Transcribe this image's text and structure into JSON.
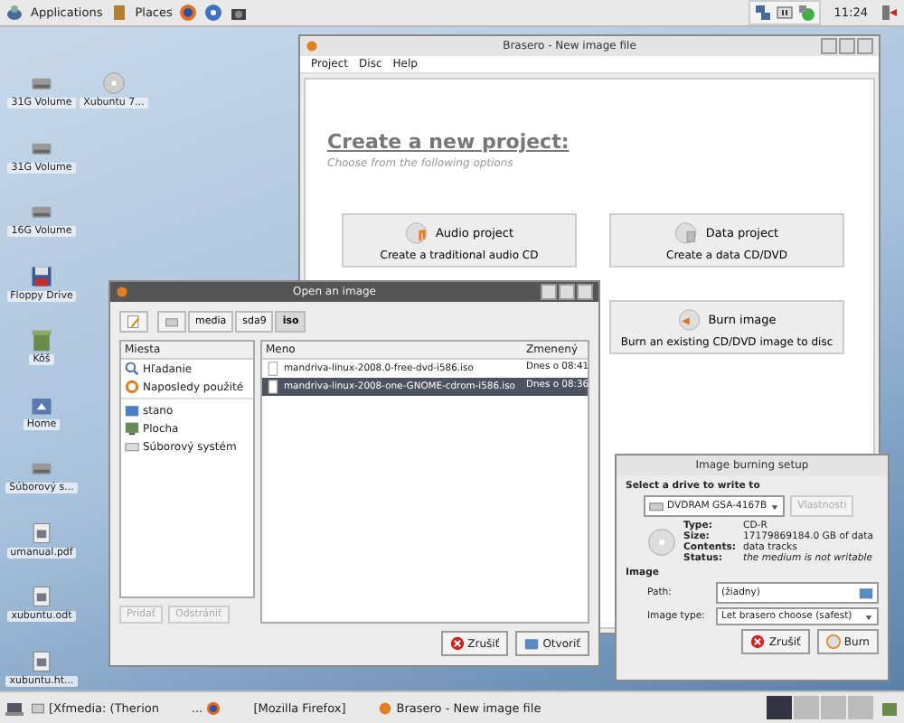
{
  "top_panel": {
    "menus": [
      {
        "label": "Applications",
        "kind": "apps"
      },
      {
        "label": "Places",
        "kind": "places"
      }
    ],
    "clock": "11:24"
  },
  "desktop_icons": [
    {
      "label": "31G Volume",
      "kind": "drive"
    },
    {
      "label": "Xubuntu 7...",
      "kind": "cdrom"
    },
    {
      "label": "31G Volume",
      "kind": "drive"
    },
    {
      "label": "16G Volume",
      "kind": "drive"
    },
    {
      "label": "Floppy Drive",
      "kind": "floppy"
    },
    {
      "label": "Kôš",
      "kind": "trash"
    },
    {
      "label": "Home",
      "kind": "home"
    },
    {
      "label": "Súborový s...",
      "kind": "drive"
    },
    {
      "label": "umanual.pdf",
      "kind": "document"
    },
    {
      "label": "xubuntu.odt",
      "kind": "document"
    },
    {
      "label": "xubuntu.ht...",
      "kind": "document"
    }
  ],
  "brasero": {
    "title": "Brasero - New image file",
    "menu": [
      "Project",
      "Disc",
      "Help"
    ],
    "heading": "Create a new project:",
    "subheading": "Choose from the following options",
    "projects": [
      {
        "title": "Audio project",
        "description": "Create a traditional audio CD",
        "kind": "audio"
      },
      {
        "title": "Data project",
        "description": "Create a data CD/DVD",
        "kind": "data"
      },
      {
        "title": "Burn image",
        "description": "Burn an existing CD/DVD image to disc",
        "kind": "burn"
      }
    ]
  },
  "open_dialog": {
    "title": "Open an image",
    "path": [
      {
        "label": "media",
        "selected": false
      },
      {
        "label": "sda9",
        "selected": false
      },
      {
        "label": "iso",
        "selected": true
      }
    ],
    "places_header": "Miesta",
    "places": [
      {
        "label": "Hľadanie",
        "kind": "search"
      },
      {
        "label": "Naposledy použité",
        "kind": "recent"
      },
      {
        "label": "stano",
        "kind": "folder"
      },
      {
        "label": "Plocha",
        "kind": "desktop"
      },
      {
        "label": "Súborový systém",
        "kind": "drive"
      }
    ],
    "place_buttons": [
      {
        "label": "Pridať",
        "disabled": true
      },
      {
        "label": "Odstrániť",
        "disabled": true
      }
    ],
    "columns": [
      "Meno",
      "Zmenený"
    ],
    "files": [
      {
        "name": "mandriva-linux-2008.0-free-dvd-i586.iso",
        "modified": "Dnes o 08:41",
        "selected": false
      },
      {
        "name": "mandriva-linux-2008-one-GNOME-cdrom-i586.iso",
        "modified": "Dnes o 08:36",
        "selected": true
      }
    ],
    "buttons": [
      {
        "label": "Zrušiť",
        "kind": "cancel"
      },
      {
        "label": "Otvoriť",
        "kind": "open"
      }
    ]
  },
  "burn_setup": {
    "title": "Image burning setup",
    "drive_prompt": "Select a drive to write to",
    "drive": "DVDRAM GSA-4167B",
    "properties_button": {
      "label": "Vlastnosti",
      "disabled": true
    },
    "info": [
      {
        "label": "Type:",
        "value": "CD-R",
        "italic": false
      },
      {
        "label": "Size:",
        "value": "17179869184.0 GB of data",
        "italic": false
      },
      {
        "label": "Contents:",
        "value": "data tracks",
        "italic": false
      },
      {
        "label": "Status:",
        "value": "the medium is not writable",
        "italic": true
      }
    ],
    "image_section": "Image",
    "path_label": "Path:",
    "path_value": "(žiadny)",
    "image_type_label": "Image type:",
    "image_type": "Let brasero choose (safest)",
    "buttons": [
      {
        "label": "Zrušiť",
        "kind": "cancel"
      },
      {
        "label": "Burn",
        "kind": "burn"
      }
    ]
  },
  "taskbar": {
    "tasks": [
      {
        "label": "[Xfmedia: (Therion",
        "kind": "media"
      },
      {
        "label": "...",
        "kind": "firefox"
      },
      {
        "label": "[Mozilla Firefox]",
        "kind": "none"
      },
      {
        "label": "Brasero - New image file",
        "kind": "brasero"
      }
    ],
    "workspaces": [
      {
        "selected": true
      },
      {
        "selected": false
      },
      {
        "selected": false
      },
      {
        "selected": false
      }
    ]
  }
}
